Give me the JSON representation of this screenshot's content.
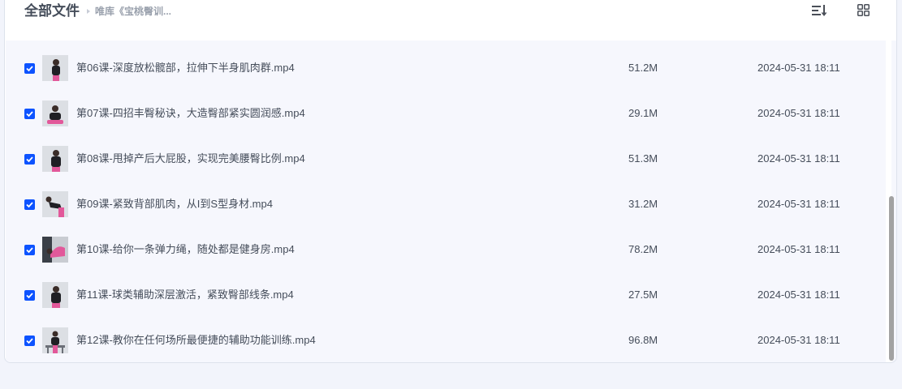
{
  "header": {
    "title": "全部文件",
    "breadcrumb": "唯库《宝桃臀训...",
    "sort_icon": "sort-list-icon",
    "view_icon": "grid-view-icon"
  },
  "colors": {
    "accent": "#0d53ff",
    "text": "#454d5a",
    "list_bg": "#f6f7fd",
    "page_bg": "#f2f4fb"
  },
  "files": [
    {
      "name": "第06课-深度放松髋部，拉伸下半身肌肉群.mp4",
      "size": "51.2M",
      "date": "2024-05-31 18:11",
      "checked": true
    },
    {
      "name": "第07课-四招丰臀秘诀，大造臀部紧实圆润感.mp4",
      "size": "29.1M",
      "date": "2024-05-31 18:11",
      "checked": true
    },
    {
      "name": "第08课-甩掉产后大屁股，实现完美腰臀比例.mp4",
      "size": "51.3M",
      "date": "2024-05-31 18:11",
      "checked": true
    },
    {
      "name": "第09课-紧致背部肌肉，从I到S型身材.mp4",
      "size": "31.2M",
      "date": "2024-05-31 18:11",
      "checked": true
    },
    {
      "name": "第10课-给你一条弹力绳，随处都是健身房.mp4",
      "size": "78.2M",
      "date": "2024-05-31 18:11",
      "checked": true
    },
    {
      "name": "第11课-球类辅助深层激活，紧致臀部线条.mp4",
      "size": "27.5M",
      "date": "2024-05-31 18:11",
      "checked": true
    },
    {
      "name": "第12课-教你在任何场所最便捷的辅助功能训练.mp4",
      "size": "96.8M",
      "date": "2024-05-31 18:11",
      "checked": true
    }
  ]
}
